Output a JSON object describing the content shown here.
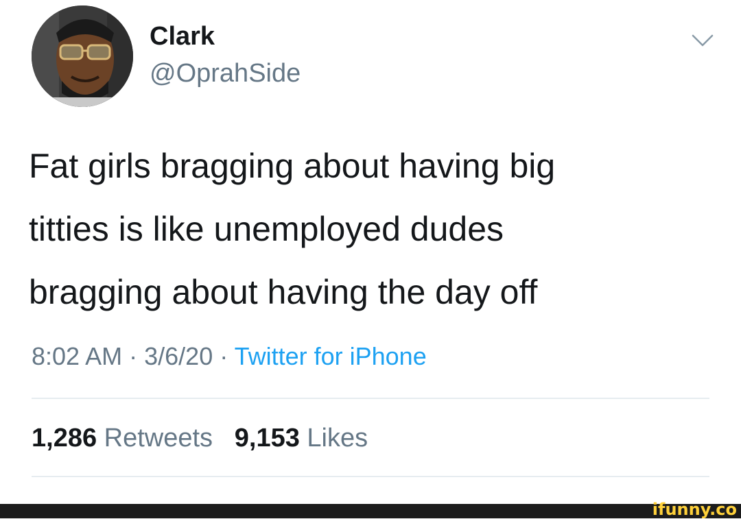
{
  "tweet": {
    "author": {
      "display_name": "Clark",
      "handle": "@OprahSide"
    },
    "text_lines": [
      "Fat girls bragging about having big",
      "titties is like unemployed dudes",
      "bragging about having the day off"
    ],
    "time": "8:02 AM",
    "date": "3/6/20",
    "separator": "·",
    "source": "Twitter for iPhone",
    "stats": {
      "retweets_count": "1,286",
      "retweets_label": "Retweets",
      "likes_count": "9,153",
      "likes_label": "Likes"
    }
  },
  "icons": {
    "menu": "chevron-down-icon",
    "avatar": "profile-photo"
  },
  "colors": {
    "text_primary": "#14171a",
    "text_secondary": "#657786",
    "link": "#1da1f2",
    "divider": "#e6ecf0",
    "watermark": "#ffd13a"
  },
  "watermark": {
    "text": "ifunny.co"
  }
}
